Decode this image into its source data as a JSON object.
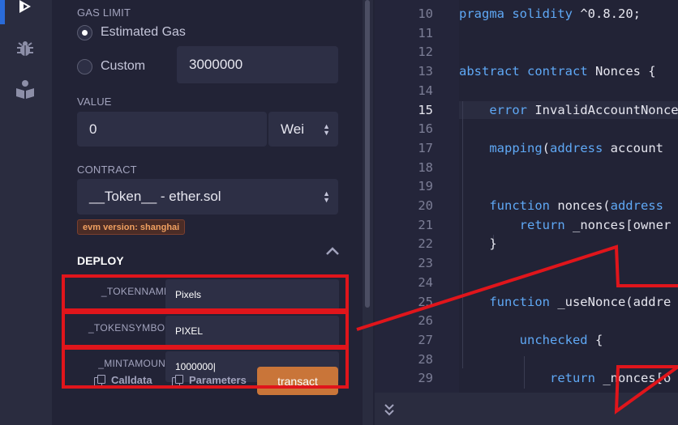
{
  "gas_limit": {
    "label": "GAS LIMIT",
    "option_estimated": "Estimated Gas",
    "option_custom": "Custom",
    "custom_value": "3000000"
  },
  "value": {
    "label": "VALUE",
    "amount": "0",
    "unit": "Wei"
  },
  "contract": {
    "label": "CONTRACT",
    "selected": "__Token__ - ether.sol",
    "evm_badge": "evm version: shanghai"
  },
  "deploy": {
    "title": "DEPLOY",
    "params": [
      {
        "label": "_TOKENNAME:",
        "value": "Pixels"
      },
      {
        "label": "_TOKENSYMBOL:",
        "value": "PIXEL"
      },
      {
        "label": "_MINTAMOUNT:",
        "value": "1000000"
      }
    ],
    "calldata_label": "Calldata",
    "parameters_label": "Parameters",
    "transact_label": "transact"
  },
  "editor": {
    "current_line": "15",
    "lines": [
      {
        "n": "10",
        "code": "pragma solidity ^0.8.20;"
      },
      {
        "n": "11",
        "code": ""
      },
      {
        "n": "12",
        "code": ""
      },
      {
        "n": "13",
        "code": "abstract contract Nonces {"
      },
      {
        "n": "14",
        "code": ""
      },
      {
        "n": "15",
        "code": "    error InvalidAccountNonce"
      },
      {
        "n": "16",
        "code": ""
      },
      {
        "n": "17",
        "code": "    mapping(address account"
      },
      {
        "n": "18",
        "code": ""
      },
      {
        "n": "19",
        "code": ""
      },
      {
        "n": "20",
        "code": "    function nonces(address"
      },
      {
        "n": "21",
        "code": "        return _nonces[owner"
      },
      {
        "n": "22",
        "code": "    }"
      },
      {
        "n": "23",
        "code": ""
      },
      {
        "n": "24",
        "code": ""
      },
      {
        "n": "25",
        "code": "    function _useNonce(addre"
      },
      {
        "n": "26",
        "code": ""
      },
      {
        "n": "27",
        "code": "        unchecked {"
      },
      {
        "n": "28",
        "code": ""
      },
      {
        "n": "29",
        "code": "            return _nonces[o"
      }
    ]
  },
  "colors": {
    "accent_blue": "#2a6bd8",
    "transact_orange": "#c97539",
    "annotation_red": "#e0151b"
  },
  "icons": [
    "deploy-icon",
    "debug-bug-icon",
    "learn-icon",
    "copy-icon",
    "chevron-up-icon",
    "double-chevron-down-icon",
    "select-arrows-icon"
  ]
}
